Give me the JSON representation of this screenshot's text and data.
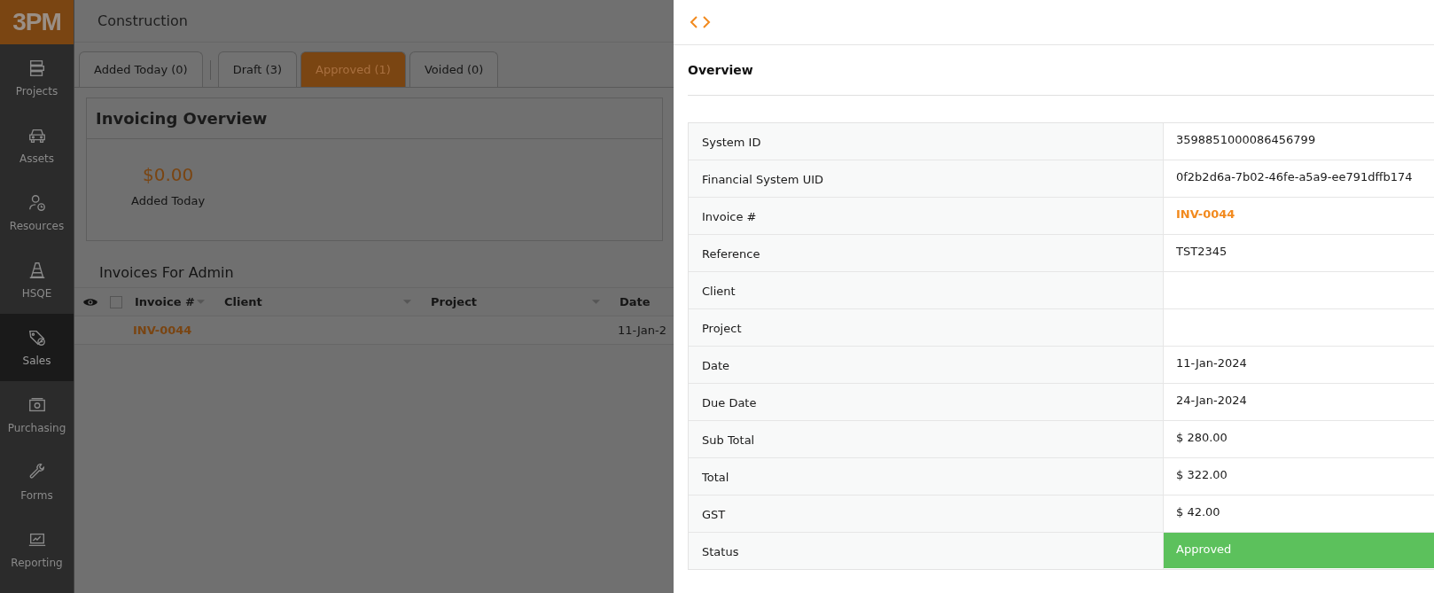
{
  "logo": {
    "text": "3PM"
  },
  "sidebar": {
    "items": [
      {
        "label": "Projects",
        "selected": false
      },
      {
        "label": "Assets",
        "selected": false
      },
      {
        "label": "Resources",
        "selected": false
      },
      {
        "label": "HSQE",
        "selected": false
      },
      {
        "label": "Sales",
        "selected": true
      },
      {
        "label": "Purchasing",
        "selected": false
      },
      {
        "label": "Forms",
        "selected": false
      },
      {
        "label": "Reporting",
        "selected": false
      }
    ]
  },
  "header": {
    "title": "Construction"
  },
  "tabs": [
    {
      "label": "Added Today (0)",
      "selected": false
    },
    {
      "label": "Draft (3)",
      "selected": false
    },
    {
      "label": "Approved (1)",
      "selected": true
    },
    {
      "label": "Voided (0)",
      "selected": false
    }
  ],
  "overview_card": {
    "title": "Invoicing Overview",
    "amount": "$0.00",
    "caption": "Added Today"
  },
  "invoices": {
    "title": "Invoices For Admin",
    "select_all_checked": false,
    "columns": [
      "Invoice #",
      "Client",
      "Project",
      "Date"
    ],
    "rows": [
      {
        "cells": [
          "INV-0044",
          "",
          "",
          "11-Jan-2"
        ]
      }
    ]
  },
  "drawer": {
    "section_title": "Overview",
    "fields": [
      {
        "label": "System ID",
        "value": "3598851000086456799",
        "kind": "text"
      },
      {
        "label": "Financial System UID",
        "value": "0f2b2d6a-7b02-46fe-a5a9-ee791dffb174",
        "kind": "text"
      },
      {
        "label": "Invoice #",
        "value": "INV-0044",
        "kind": "link"
      },
      {
        "label": "Reference",
        "value": "TST2345",
        "kind": "text"
      },
      {
        "label": "Client",
        "kind": "text"
      },
      {
        "label": "Project",
        "kind": "text"
      },
      {
        "label": "Date",
        "value": "11-Jan-2024",
        "kind": "text"
      },
      {
        "label": "Due Date",
        "value": "24-Jan-2024",
        "kind": "text"
      },
      {
        "label": "Sub Total",
        "value": "$ 280.00",
        "kind": "text"
      },
      {
        "label": "Total",
        "value": "$ 322.00",
        "kind": "text"
      },
      {
        "label": "GST",
        "value": "$ 42.00",
        "kind": "text"
      },
      {
        "label": "Status",
        "value": "Approved",
        "kind": "status",
        "color": "#5cc15c"
      }
    ]
  }
}
